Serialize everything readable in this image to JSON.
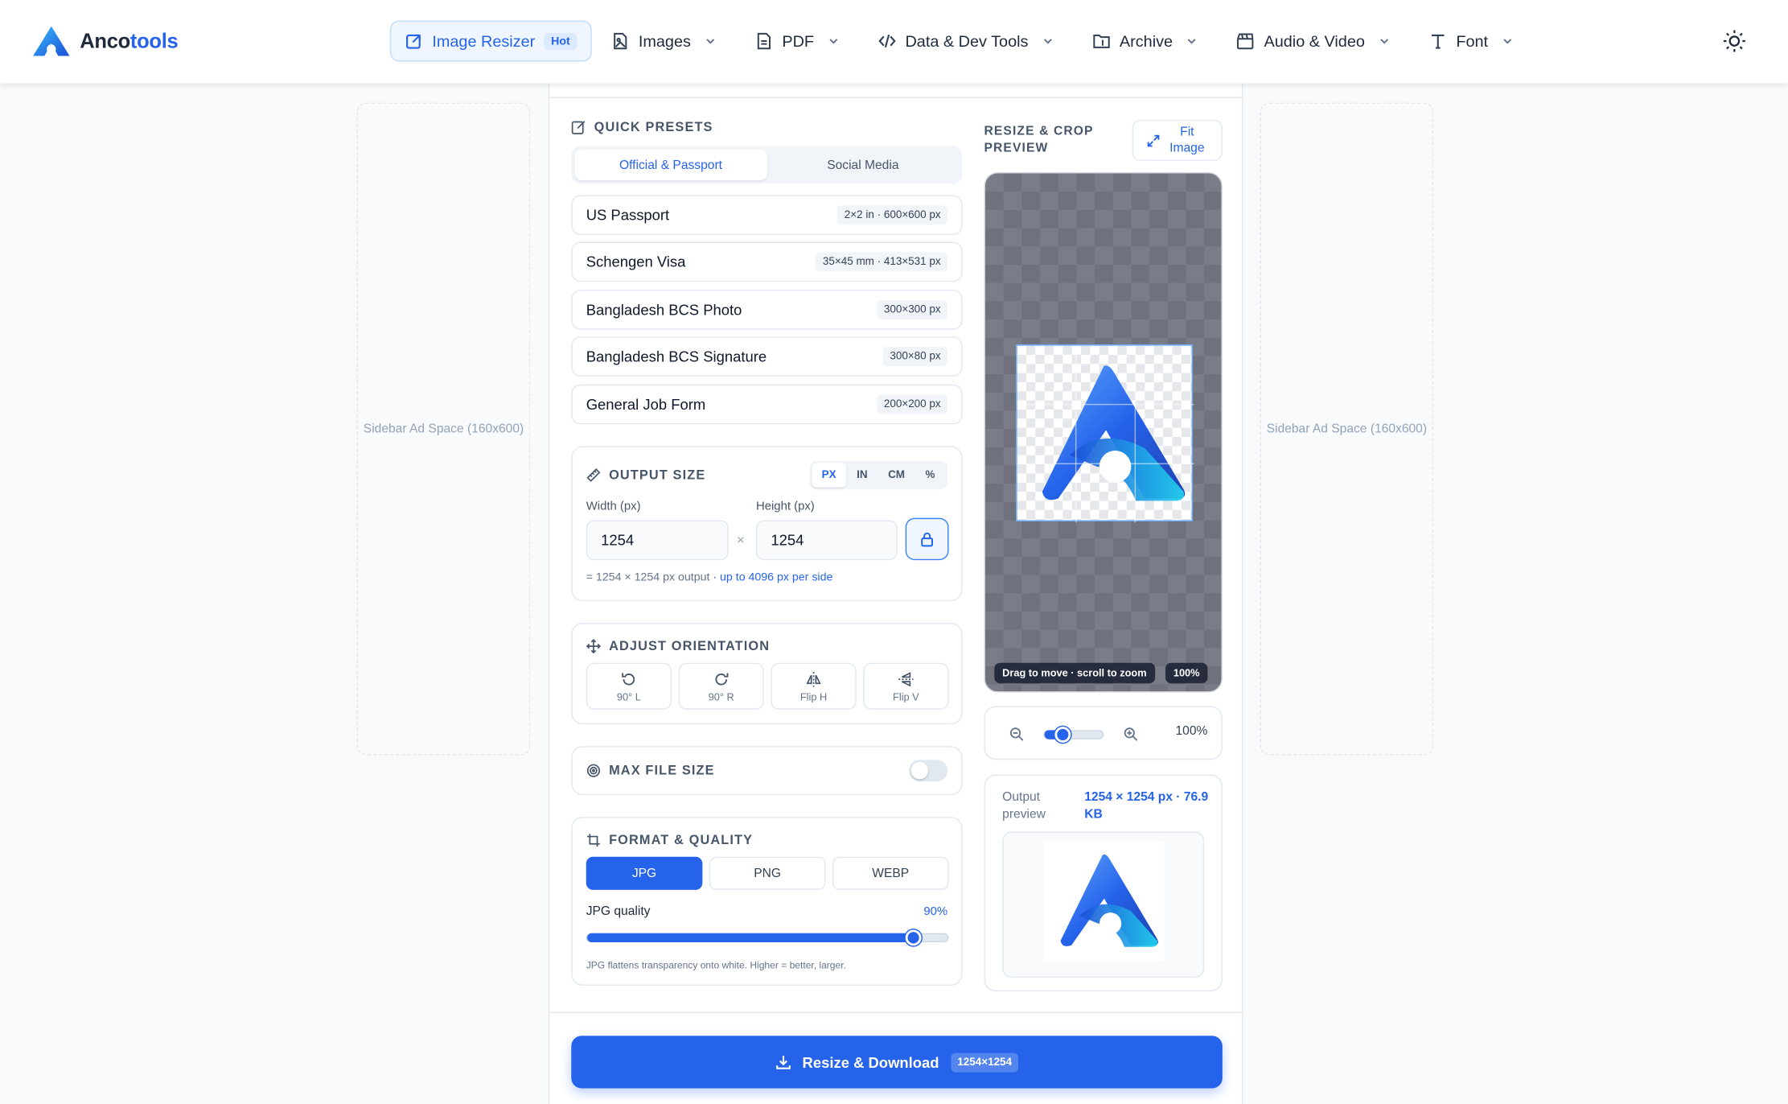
{
  "brand": {
    "name_part1": "Anco",
    "name_part2": "tools"
  },
  "nav": {
    "items": [
      {
        "label": "Image Resizer",
        "badge": "Hot"
      },
      {
        "label": "Images"
      },
      {
        "label": "PDF"
      },
      {
        "label": "Data & Dev Tools"
      },
      {
        "label": "Archive"
      },
      {
        "label": "Audio & Video"
      },
      {
        "label": "Font"
      }
    ]
  },
  "ads": {
    "left": "Sidebar Ad Space (160x600)",
    "right": "Sidebar Ad Space (160x600)"
  },
  "presets": {
    "title": "QUICK PRESETS",
    "tabs": [
      "Official & Passport",
      "Social Media"
    ],
    "active_tab": "Official & Passport",
    "items": [
      {
        "name": "US Passport",
        "size": "2×2 in · 600×600 px"
      },
      {
        "name": "Schengen Visa",
        "size": "35×45 mm · 413×531 px"
      },
      {
        "name": "Bangladesh BCS Photo",
        "size": "300×300 px"
      },
      {
        "name": "Bangladesh BCS Signature",
        "size": "300×80 px"
      },
      {
        "name": "General Job Form",
        "size": "200×200 px"
      }
    ]
  },
  "output_size": {
    "title": "OUTPUT SIZE",
    "units": [
      "PX",
      "IN",
      "CM",
      "%"
    ],
    "active_unit": "PX",
    "width_label": "Width (px)",
    "height_label": "Height (px)",
    "width_value": "1254",
    "height_value": "1254",
    "times": "×",
    "note": "= 1254 × 1254 px output",
    "note_link": "· up to 4096 px per side"
  },
  "orientation": {
    "title": "ADJUST ORIENTATION",
    "buttons": [
      "90° L",
      "90° R",
      "Flip H",
      "Flip V"
    ]
  },
  "max_file_size": {
    "title": "MAX FILE SIZE",
    "enabled": false
  },
  "format": {
    "title": "FORMAT & QUALITY",
    "options": [
      "JPG",
      "PNG",
      "WEBP"
    ],
    "active": "JPG",
    "quality_label": "JPG quality",
    "quality_value": "90%",
    "quality_fraction": 0.9,
    "hint": "JPG flattens transparency onto white. Higher = better, larger."
  },
  "preview": {
    "title": "RESIZE & CROP PREVIEW",
    "fit_label": "Fit Image",
    "hint_chip": "Drag to move · scroll to zoom",
    "zoom_chip": "100%",
    "zoom_value": "100%",
    "zoom_fraction": 0.3,
    "output_label": "Output preview",
    "output_value": "1254 × 1254 px · 76.9 KB"
  },
  "download": {
    "label": "Resize & Download",
    "badge": "1254×1254"
  },
  "colors": {
    "accent": "#2563eb",
    "accent_light": "#eff6ff"
  }
}
